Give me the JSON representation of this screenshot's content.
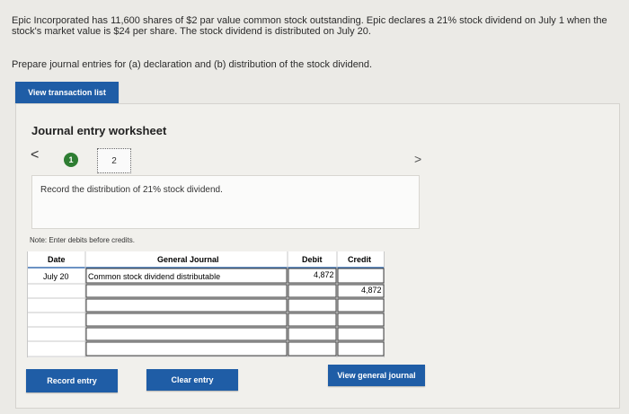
{
  "problem": {
    "text": "Epic Incorporated has 11,600 shares of $2 par value common stock outstanding. Epic declares a 21% stock dividend on July 1 when the stock's market value is $24 per share. The stock dividend is distributed on July 20.",
    "instruction": "Prepare journal entries for (a) declaration and (b) distribution of the stock dividend."
  },
  "buttons": {
    "view_transaction_list": "View transaction list",
    "record_entry": "Record entry",
    "clear_entry": "Clear entry",
    "view_general_journal": "View general journal"
  },
  "worksheet": {
    "title": "Journal entry worksheet",
    "prev": "<",
    "next": ">",
    "steps": [
      "1",
      "2"
    ],
    "record_text": "Record the distribution of 21% stock dividend.",
    "note": "Note: Enter debits before credits."
  },
  "table": {
    "headers": {
      "date": "Date",
      "journal": "General Journal",
      "debit": "Debit",
      "credit": "Credit"
    },
    "rows": [
      {
        "date": "July 20",
        "account": "Common stock dividend distributable",
        "debit": "4,872",
        "credit": ""
      },
      {
        "date": "",
        "account": "",
        "debit": "",
        "credit": "4,872"
      },
      {
        "date": "",
        "account": "",
        "debit": "",
        "credit": ""
      },
      {
        "date": "",
        "account": "",
        "debit": "",
        "credit": ""
      },
      {
        "date": "",
        "account": "",
        "debit": "",
        "credit": ""
      },
      {
        "date": "",
        "account": "",
        "debit": "",
        "credit": ""
      }
    ]
  },
  "colors": {
    "primary_button": "#1f5da6",
    "step_active": "#2e7d32",
    "header_rule": "#3a6fb0"
  }
}
